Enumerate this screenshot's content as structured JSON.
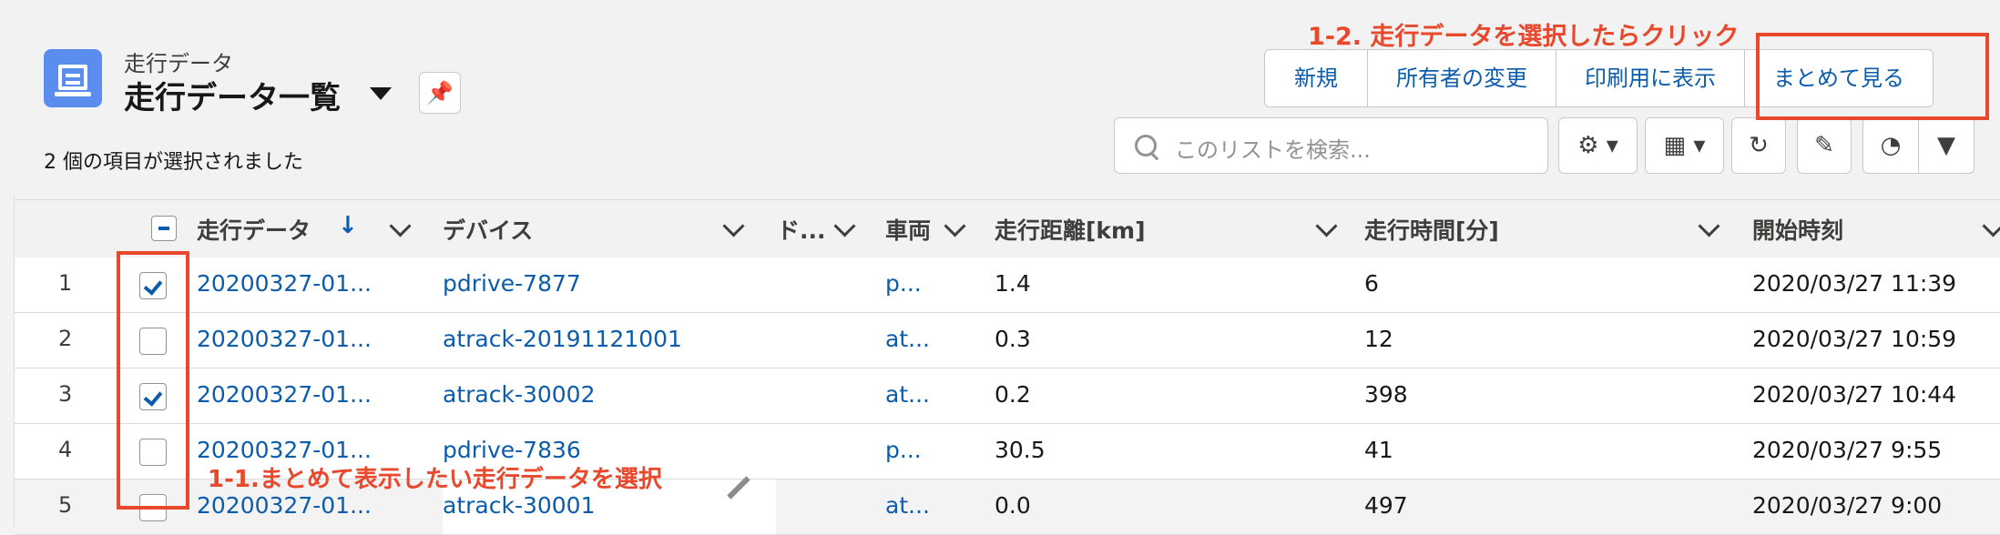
{
  "header": {
    "object_label": "走行データ",
    "list_title": "走行データ一覧",
    "selected_info": "2 個の項目が選択されました",
    "buttons": [
      "新規",
      "所有者の変更",
      "印刷用に表示",
      "まとめて見る"
    ],
    "search_placeholder": "このリストを検索..."
  },
  "columns": [
    "走行データ",
    "デバイス",
    "ド...",
    "車両",
    "走行距離[km]",
    "走行時間[分]",
    "開始時刻"
  ],
  "rows": [
    {
      "num": "1",
      "checked": true,
      "data": "20200327-01...",
      "device": "pdrive-7877",
      "vehicle": "p...",
      "distance": "1.4",
      "time": "6",
      "start": "2020/03/27 11:39"
    },
    {
      "num": "2",
      "checked": false,
      "data": "20200327-01...",
      "device": "atrack-20191121001",
      "vehicle": "at...",
      "distance": "0.3",
      "time": "12",
      "start": "2020/03/27 10:59"
    },
    {
      "num": "3",
      "checked": true,
      "data": "20200327-01...",
      "device": "atrack-30002",
      "vehicle": "at...",
      "distance": "0.2",
      "time": "398",
      "start": "2020/03/27 10:44"
    },
    {
      "num": "4",
      "checked": false,
      "data": "20200327-01...",
      "device": "pdrive-7836",
      "vehicle": "p...",
      "distance": "30.5",
      "time": "41",
      "start": "2020/03/27 9:55"
    },
    {
      "num": "5",
      "checked": false,
      "data": "20200327-01...",
      "device": "atrack-30001",
      "vehicle": "at...",
      "distance": "0.0",
      "time": "497",
      "start": "2020/03/27 9:00"
    }
  ],
  "annotations": {
    "step_1_1": "1-1.まとめて表示したい走行データを選択",
    "step_1_2": "1-2. 走行データを選択したらクリック"
  },
  "icons": {
    "object": "record-list-icon",
    "pin": "pin-icon",
    "search": "search-icon",
    "settings": "gear-icon",
    "display": "table-view-icon",
    "refresh": "refresh-icon",
    "edit": "pencil-icon",
    "charts": "pie-chart-icon",
    "filter": "filter-icon"
  },
  "colors": {
    "accent": "#0b5cab",
    "annotation": "#e8492d",
    "object_icon": "#5b8def"
  }
}
